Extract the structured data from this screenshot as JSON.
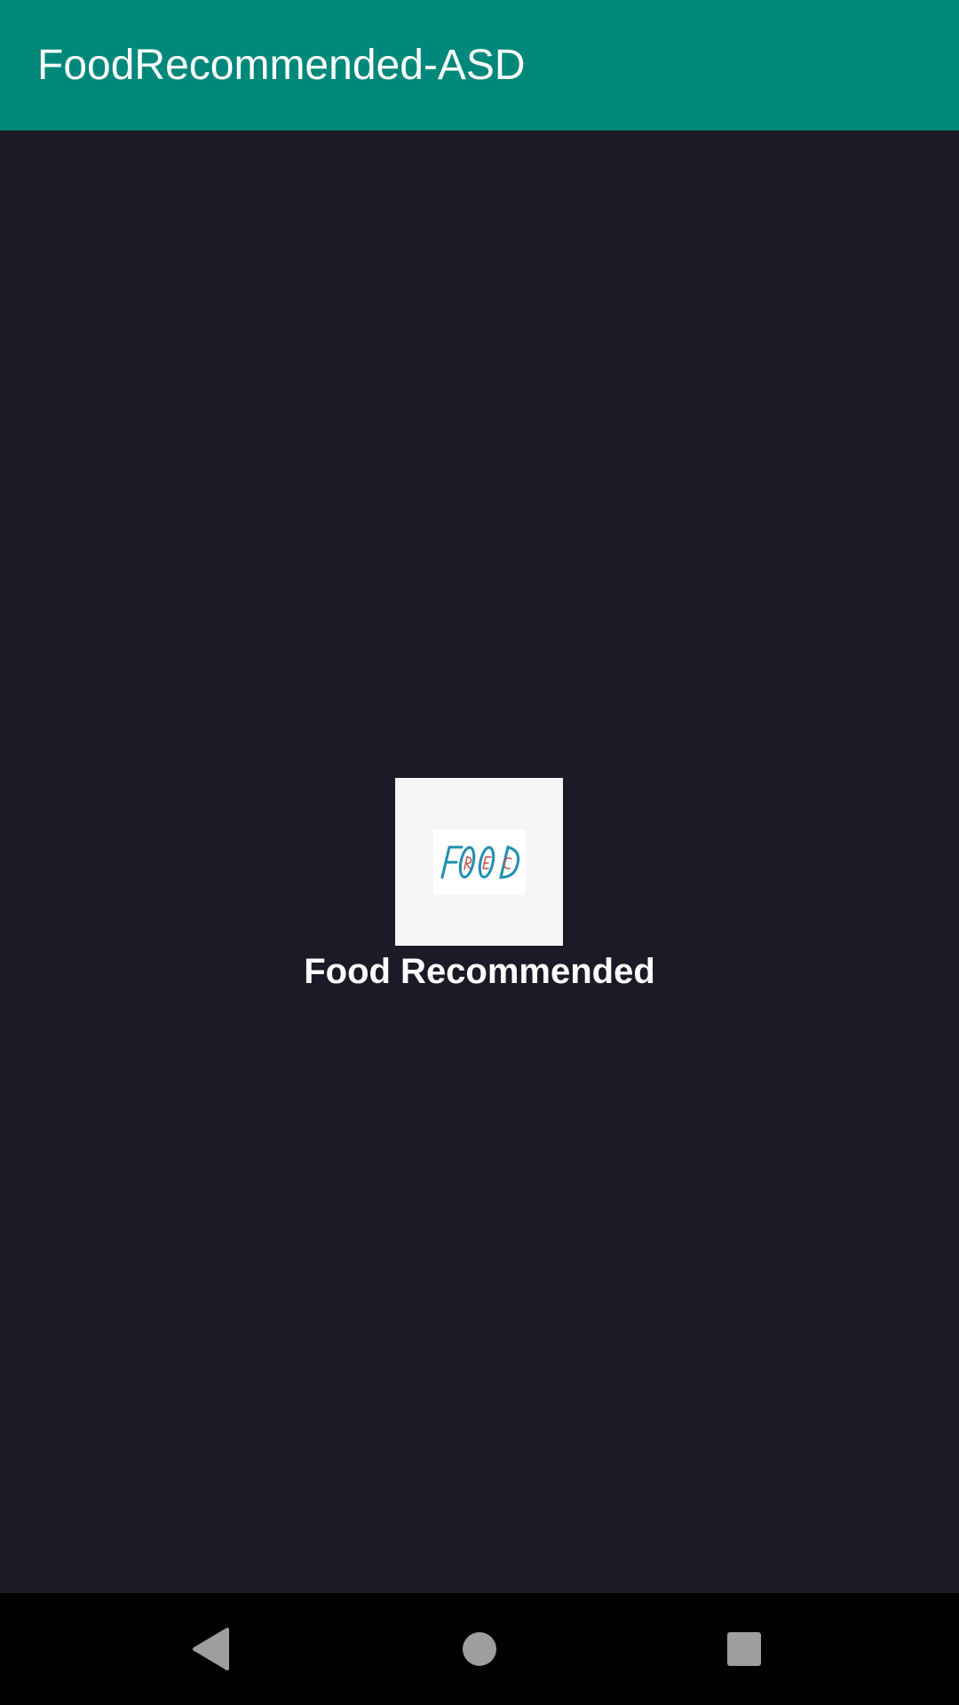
{
  "app_bar": {
    "title": "FoodRecommended-ASD",
    "color": "#00887a"
  },
  "splash": {
    "logo": {
      "icon": "food-rec-logo",
      "text": "FOOD REC"
    },
    "title": "Food Recommended"
  },
  "nav_bar": {
    "back": "back-icon",
    "home": "home-icon",
    "recents": "recents-icon"
  }
}
